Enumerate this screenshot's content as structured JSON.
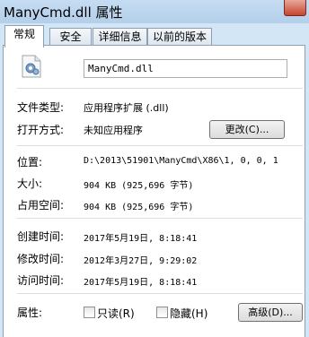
{
  "window": {
    "title": "ManyCmd.dll 属性"
  },
  "tabs": [
    "常规",
    "安全",
    "详细信息",
    "以前的版本"
  ],
  "file": {
    "name": "ManyCmd.dll"
  },
  "labels": {
    "type": "文件类型:",
    "opens_with": "打开方式:",
    "location": "位置:",
    "size": "大小:",
    "size_on_disk": "占用空间:",
    "created": "创建时间:",
    "modified": "修改时间:",
    "accessed": "访问时间:",
    "attributes": "属性:"
  },
  "values": {
    "type": "应用程序扩展 (.dll)",
    "opens_with": "未知应用程序",
    "location": "D:\\2013\\51901\\ManyCmd\\X86\\1, 0, 0, 1",
    "size": "904 KB (925,696 字节)",
    "size_on_disk": "904 KB (925,696 字节)",
    "created": "2017年5月19日, 8:18:41",
    "modified": "2012年3月27日, 9:29:02",
    "accessed": "2017年5月19日, 8:18:41"
  },
  "buttons": {
    "change": "更改(C)...",
    "advanced": "高级(D)..."
  },
  "checkboxes": {
    "readonly": "只读(R)",
    "hidden": "隐藏(H)"
  }
}
